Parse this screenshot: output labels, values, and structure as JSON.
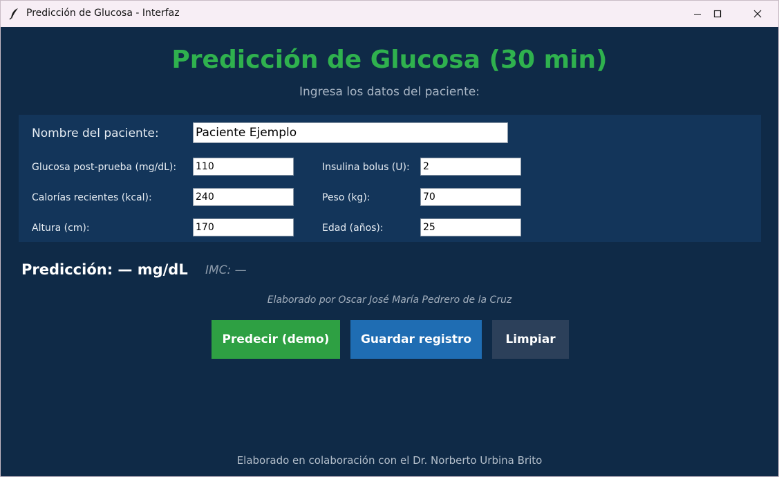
{
  "window": {
    "title": "Predicción de Glucosa - Interfaz"
  },
  "header": {
    "title": "Predicción de Glucosa (30 min)",
    "subtitle": "Ingresa los datos del paciente:"
  },
  "form": {
    "nombre": {
      "label": "Nombre del paciente:",
      "value": "Paciente Ejemplo"
    },
    "glucosa": {
      "label": "Glucosa post-prueba (mg/dL):",
      "value": "110"
    },
    "insulina": {
      "label": "Insulina bolus (U):",
      "value": "2"
    },
    "calorias": {
      "label": "Calorías recientes (kcal):",
      "value": "240"
    },
    "peso": {
      "label": "Peso (kg):",
      "value": "70"
    },
    "altura": {
      "label": "Altura (cm):",
      "value": "170"
    },
    "edad": {
      "label": "Edad (años):",
      "value": "25"
    }
  },
  "result": {
    "prediction": "Predicción: — mg/dL",
    "imc": "IMC: —"
  },
  "credit": "Elaborado por Oscar José María Pedrero de la Cruz",
  "buttons": {
    "predict": "Predecir (demo)",
    "save": "Guardar registro",
    "clear": "Limpiar"
  },
  "footer": "Elaborado en colaboración con el Dr. Norberto Urbina Brito",
  "colors": {
    "background": "#0f2a47",
    "panel": "#13355a",
    "title_green": "#2fb14e",
    "predict_button": "#2ea043",
    "save_button": "#1f6db3",
    "clear_button": "#2c405a"
  },
  "icons": {
    "app": "feather-icon",
    "minimize": "minimize-icon",
    "maximize": "maximize-icon",
    "close": "close-icon"
  }
}
